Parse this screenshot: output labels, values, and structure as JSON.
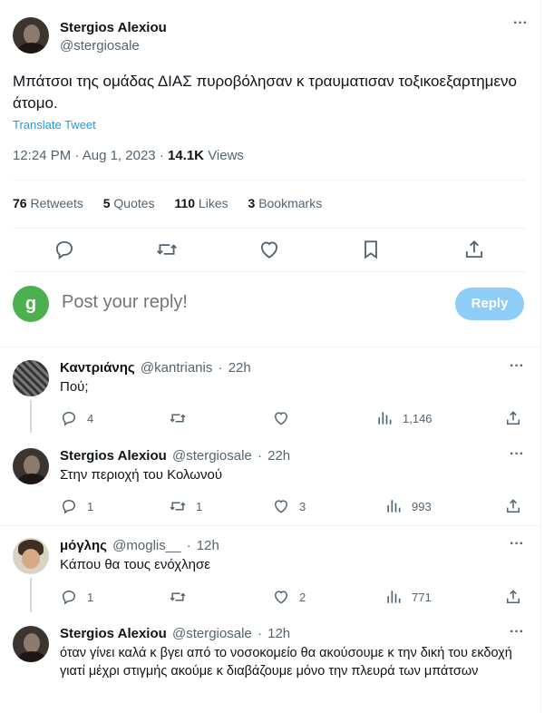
{
  "tweet": {
    "author_name": "Stergios Alexiou",
    "author_handle": "@stergiosale",
    "more_label": "···",
    "text": "Μπάτσοι της ομάδας ΔΙΑΣ πυροβόλησαν κ τραυματισαν τοξικοεξαρτημενο άτομο.",
    "translate_label": "Translate Tweet",
    "time": "12:24 PM",
    "date": "Aug 1, 2023",
    "views_count": "14.1K",
    "views_label": "Views",
    "retweets_count": "76",
    "retweets_label": "Retweets",
    "quotes_count": "5",
    "quotes_label": "Quotes",
    "likes_count": "110",
    "likes_label": "Likes",
    "bookmarks_count": "3",
    "bookmarks_label": "Bookmarks"
  },
  "composer": {
    "avatar_letter": "g",
    "avatar_color": "#4caf50",
    "placeholder": "Post your reply!",
    "reply_button": "Reply"
  },
  "replies": [
    {
      "name": "Καντριάνης",
      "handle": "@kantrianis",
      "time": "22h",
      "text": "Πού;",
      "replies": "4",
      "retweets": "",
      "likes": "",
      "views": "1,146"
    },
    {
      "name": "Stergios Alexiou",
      "handle": "@stergiosale",
      "time": "22h",
      "text": "Στην περιοχή του Κολωνού",
      "replies": "1",
      "retweets": "1",
      "likes": "3",
      "views": "993"
    },
    {
      "name": "μόγλης",
      "handle": "@moglis__",
      "time": "12h",
      "text": "Κάπου θα τους ενόχλησε",
      "replies": "1",
      "retweets": "",
      "likes": "2",
      "views": "771"
    },
    {
      "name": "Stergios Alexiou",
      "handle": "@stergiosale",
      "time": "12h",
      "text": "όταν γίνει καλά κ βγει από το νοσοκομείο θα ακούσουμε κ την δική του εκδοχή γιατί μέχρι στιγμής ακούμε κ διαβάζουμε μόνο την πλευρά των μπάτσων"
    }
  ],
  "separator": "·",
  "colors": {
    "accent": "#1d9bf0",
    "secondary_text": "#536471",
    "reply_button_disabled": "#8ecdf8"
  }
}
